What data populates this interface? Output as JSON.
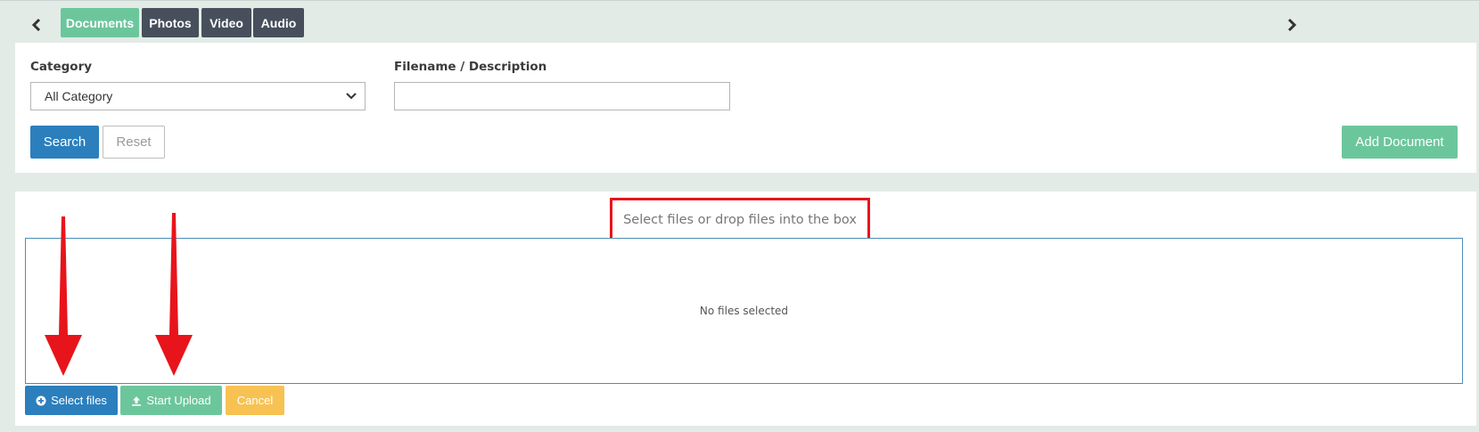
{
  "tabs": [
    {
      "label": "Documents",
      "active": true
    },
    {
      "label": "Photos",
      "active": false
    },
    {
      "label": "Video",
      "active": false
    },
    {
      "label": "Audio",
      "active": false
    }
  ],
  "nav": {
    "prev_icon": "chevron-left-icon",
    "next_icon": "chevron-right-icon"
  },
  "filters": {
    "category_label": "Category",
    "category_value": "All Category",
    "filename_label": "Filename / Description",
    "filename_value": ""
  },
  "buttons": {
    "search": "Search",
    "reset": "Reset",
    "add_document": "Add Document"
  },
  "upload": {
    "drop_hint": "Select files or drop files into the box",
    "empty_text": "No files selected",
    "select_files": "Select files",
    "start_upload": "Start Upload",
    "cancel": "Cancel"
  },
  "colors": {
    "background": "#e3ebe7",
    "green": "#6cc69c",
    "dark_tab": "#474f5c",
    "blue": "#2b7fbd",
    "yellow": "#f7c252",
    "annotation_red": "#e8141b"
  }
}
